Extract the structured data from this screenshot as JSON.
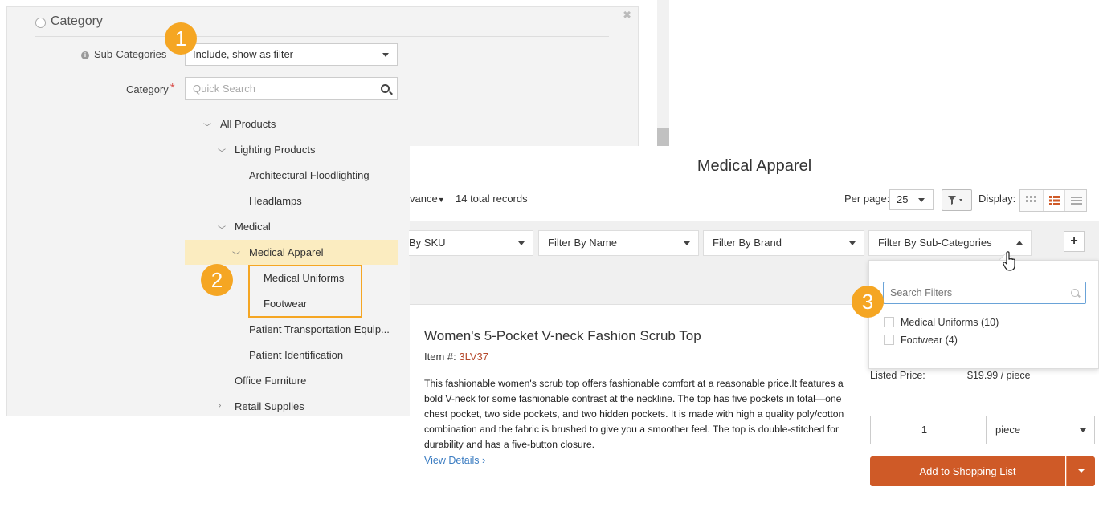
{
  "admin": {
    "section_title": "Category",
    "subcat_label": "Sub-Categories",
    "subcat_value": "Include, show as filter",
    "category_label": "Category",
    "required_mark": "*",
    "search_placeholder": "Quick Search",
    "tree": {
      "all_products": "All Products",
      "lighting": "Lighting Products",
      "arch_flood": "Architectural Floodlighting",
      "headlamps": "Headlamps",
      "medical": "Medical",
      "medical_apparel": "Medical Apparel",
      "medical_uniforms": "Medical Uniforms",
      "footwear": "Footwear",
      "patient_transport": "Patient Transportation Equip...",
      "patient_id": "Patient Identification",
      "office_furniture": "Office Furniture",
      "retail_supplies": "Retail Supplies"
    }
  },
  "badges": {
    "one": "1",
    "two": "2",
    "three": "3"
  },
  "store": {
    "page_title": "Medical Apparel",
    "sort_fragment": "vance",
    "total_records": "14 total records",
    "per_page_label": "Per page:",
    "per_page_value": "25",
    "display_label": "Display:",
    "filters": {
      "sku": "By SKU",
      "name": "Filter By Name",
      "brand": "Filter By Brand",
      "subcats": "Filter By Sub-Categories"
    },
    "product": {
      "title": "Women's 5-Pocket V-neck Fashion Scrub Top",
      "item_label": "Item #:",
      "item_no": "3LV37",
      "description": "This fashionable women's scrub top offers fashionable comfort at a reasonable price.It features a bold V-neck for some fashionable contrast at the neckline. The top has five pockets in total—one chest pocket, two side pockets, and two hidden pockets. It is made with high a quality poly/cotton combination and the fabric is brushed to give you a smoother feel. The top is double-stitched for durability and has a five-button closure.",
      "view_details": "View Details ›",
      "listed_price_label": "Listed Price:",
      "listed_price_value": "$19.99 / piece",
      "qty": "1",
      "unit": "piece",
      "add_button": "Add to Shopping List"
    },
    "dropdown": {
      "search_placeholder": "Search Filters",
      "options": [
        "Medical Uniforms (10)",
        "Footwear (4)"
      ]
    }
  }
}
